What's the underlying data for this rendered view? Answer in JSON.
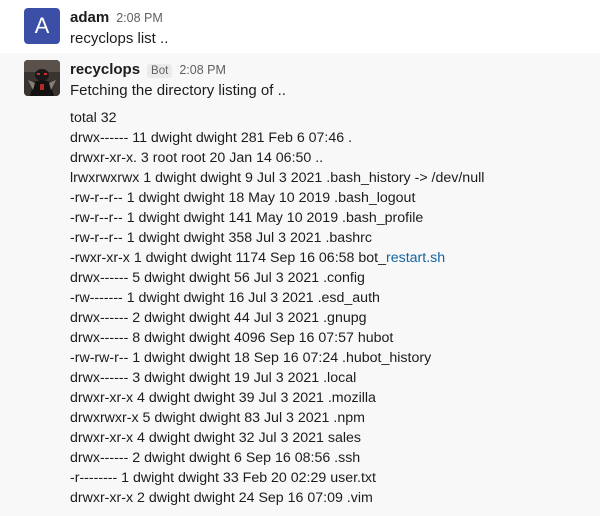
{
  "messages": [
    {
      "user": "adam",
      "avatar_letter": "A",
      "avatar_color": "#3b4fa6",
      "time": "2:08 PM",
      "text": "recyclops list .."
    },
    {
      "user": "recyclops",
      "avatar_icon": "robot-avatar-icon",
      "badge": "Bot",
      "time": "2:08 PM",
      "text": "Fetching the directory listing of ..",
      "listing": [
        {
          "text": "total 32"
        },
        {
          "text": "drwx------ 11 dwight dwight 281 Feb 6 07:46 ."
        },
        {
          "text": "drwxr-xr-x. 3 root root 20 Jan 14 06:50 .."
        },
        {
          "text": "lrwxrwxrwx 1 dwight dwight 9 Jul 3 2021 .bash_history -> /dev/null"
        },
        {
          "text": "-rw-r--r-- 1 dwight dwight 18 May 10 2019 .bash_logout"
        },
        {
          "text": "-rw-r--r-- 1 dwight dwight 141 May 10 2019 .bash_profile"
        },
        {
          "text": "-rw-r--r-- 1 dwight dwight 358 Jul 3 2021 .bashrc"
        },
        {
          "text": "-rwxr-xr-x 1 dwight dwight 1174 Sep 16 06:58 bot_",
          "link": "restart.sh"
        },
        {
          "text": "drwx------ 5 dwight dwight 56 Jul 3 2021 .config"
        },
        {
          "text": "-rw------- 1 dwight dwight 16 Jul 3 2021 .esd_auth"
        },
        {
          "text": "drwx------ 2 dwight dwight 44 Jul 3 2021 .gnupg"
        },
        {
          "text": "drwx------ 8 dwight dwight 4096 Sep 16 07:57 hubot"
        },
        {
          "text": "-rw-rw-r-- 1 dwight dwight 18 Sep 16 07:24 .hubot_history"
        },
        {
          "text": "drwx------ 3 dwight dwight 19 Jul 3 2021 .local"
        },
        {
          "text": "drwxr-xr-x 4 dwight dwight 39 Jul 3 2021 .mozilla"
        },
        {
          "text": "drwxrwxr-x 5 dwight dwight 83 Jul 3 2021 .npm"
        },
        {
          "text": "drwxr-xr-x 4 dwight dwight 32 Jul 3 2021 sales"
        },
        {
          "text": "drwx------ 2 dwight dwight 6 Sep 16 08:56 .ssh"
        },
        {
          "text": "-r-------- 1 dwight dwight 33 Feb 20 02:29 user.txt"
        },
        {
          "text": "drwxr-xr-x 2 dwight dwight 24 Sep 16 07:09 .vim"
        }
      ]
    }
  ]
}
